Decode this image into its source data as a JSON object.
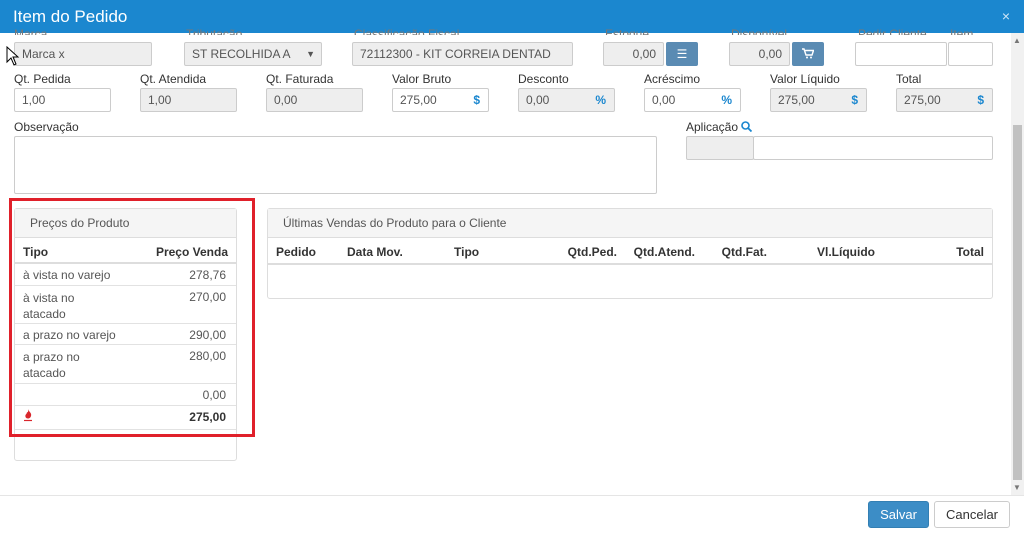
{
  "window": {
    "title": "Item do Pedido",
    "close": "×"
  },
  "top_row": {
    "labels": [
      "Marca",
      "Tributação",
      "Classificação Fiscal",
      "Estoque",
      "Disponível",
      "Pedir Cliente",
      "Item"
    ],
    "marca": "Marca x",
    "tributacao": "ST RECOLHIDA A",
    "classificacao": "72112300 - KIT CORREIA DENTAD",
    "estoque": "0,00",
    "disponivel": "0,00",
    "pedir_cliente": "",
    "item": ""
  },
  "fields": {
    "qt_pedida": {
      "label": "Qt. Pedida",
      "value": "1,00"
    },
    "qt_atendida": {
      "label": "Qt. Atendida",
      "value": "1,00"
    },
    "qt_faturada": {
      "label": "Qt. Faturada",
      "value": "0,00"
    },
    "valor_bruto": {
      "label": "Valor Bruto",
      "value": "275,00",
      "suffix": "$"
    },
    "desconto": {
      "label": "Desconto",
      "value": "0,00",
      "suffix": "%"
    },
    "acrescimo": {
      "label": "Acréscimo",
      "value": "0,00",
      "suffix": "%"
    },
    "valor_liquido": {
      "label": "Valor Líquido",
      "value": "275,00",
      "suffix": "$"
    },
    "total": {
      "label": "Total",
      "value": "275,00",
      "suffix": "$"
    }
  },
  "observacao": {
    "label": "Observação",
    "value": ""
  },
  "aplicacao": {
    "label": "Aplicação",
    "code": "",
    "desc": ""
  },
  "precos": {
    "title": "Preços do Produto",
    "headers": [
      "Tipo",
      "Preço Venda"
    ],
    "rows": [
      {
        "tipo": "à vista no varejo",
        "preco": "278,76"
      },
      {
        "tipo": "à vista no atacado",
        "preco": "270,00"
      },
      {
        "tipo": "a prazo no varejo",
        "preco": "290,00"
      },
      {
        "tipo": "a prazo no atacado",
        "preco": "280,00"
      },
      {
        "tipo": "",
        "preco": "0,00"
      }
    ],
    "total": "275,00"
  },
  "ultimas_vendas": {
    "title": "Últimas Vendas do Produto para o Cliente",
    "headers": [
      "Pedido",
      "Data Mov.",
      "Tipo",
      "Qtd.Ped.",
      "Qtd.Atend.",
      "Qtd.Fat.",
      "Vl.Líquido",
      "Total"
    ]
  },
  "footer": {
    "save": "Salvar",
    "cancel": "Cancelar"
  },
  "colors": {
    "titlebar": "#1b87cf",
    "highlight": "#e0202a",
    "primary_button": "#3c8dc6"
  }
}
